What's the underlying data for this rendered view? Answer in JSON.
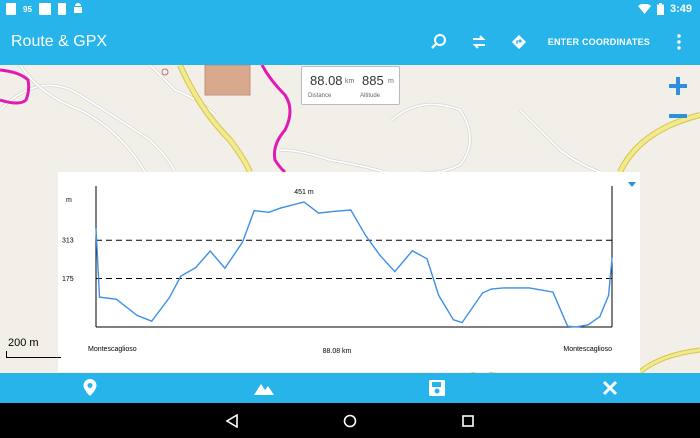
{
  "status_bar": {
    "notif_count": "95",
    "time": "3:49",
    "icons": [
      "photo-icon",
      "flipboard-icon",
      "sim-icon",
      "android-icon",
      "wifi-icon",
      "battery-icon"
    ]
  },
  "app_bar": {
    "title": "Route & GPX",
    "enter_coordinates": "ENTER COORDINATES",
    "actions": [
      "search-icon",
      "swap-icon",
      "directions-icon",
      "more-icon"
    ]
  },
  "info_box": {
    "distance_value": "88.08",
    "distance_unit": "km",
    "distance_label": "Distance",
    "altitude_value": "885",
    "altitude_unit": "m",
    "altitude_label": "Altitude"
  },
  "map_controls": {
    "zoom_in": "+",
    "zoom_out": "−"
  },
  "scale_bar": {
    "label": "200 m"
  },
  "chart_data": {
    "type": "line",
    "ylabel": "m",
    "y_ticks": [
      175,
      313
    ],
    "reference_lines": [
      175,
      313
    ],
    "ylim": [
      0,
      451
    ],
    "xlim": [
      0,
      88.08
    ],
    "max_label": "451 m",
    "x_start_label": "Montescaglioso",
    "x_end_label": "Montescaglioso",
    "x_total_label": "88.08 km",
    "series": [
      {
        "color": "#3d8fe6",
        "x": [
          0.0,
          0.6,
          3.5,
          7.0,
          9.5,
          12.5,
          14.5,
          17.0,
          19.5,
          22.0,
          25.0,
          27.0,
          29.5,
          31.5,
          35.5,
          38.0,
          40.5,
          43.5,
          46.0,
          48.5,
          51.0,
          54.0,
          56.5,
          58.5,
          61.0,
          62.5,
          66.0,
          67.5,
          69.5,
          74.0,
          78.0,
          80.5,
          82.0,
          84.0,
          86.0,
          87.5,
          88.08
        ],
        "y": [
          354,
          108,
          100,
          42,
          21,
          105,
          184,
          214,
          274,
          212,
          306,
          420,
          414,
          429,
          451,
          411,
          417,
          422,
          331,
          258,
          200,
          275,
          246,
          114,
          26,
          16,
          123,
          137,
          141,
          141,
          126,
          3,
          0,
          8,
          37,
          114,
          248
        ]
      }
    ]
  },
  "bottom_bar": [
    "location-pin-icon",
    "mountain-icon",
    "save-icon",
    "close-icon"
  ],
  "nav_bar": [
    "back-icon",
    "home-icon",
    "recents-icon"
  ]
}
